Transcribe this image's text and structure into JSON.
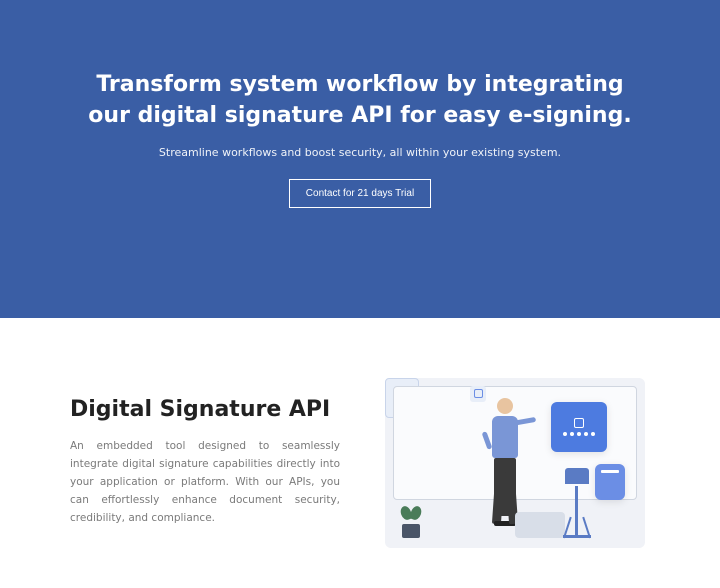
{
  "hero": {
    "title": "Transform system workflow by integrating our digital signature API for easy e-signing.",
    "subtitle": "Streamline workflows and boost security, all within your existing system.",
    "cta_label": "Contact for 21 days Trial"
  },
  "section": {
    "heading": "Digital Signature API",
    "body": "An embedded tool designed to seamlessly integrate digital signature capabilities directly into your application or platform. With our APIs, you can effortlessly enhance document security, credibility, and compliance."
  },
  "colors": {
    "hero_bg": "#3a5ea5",
    "accent": "#4d7be0"
  }
}
